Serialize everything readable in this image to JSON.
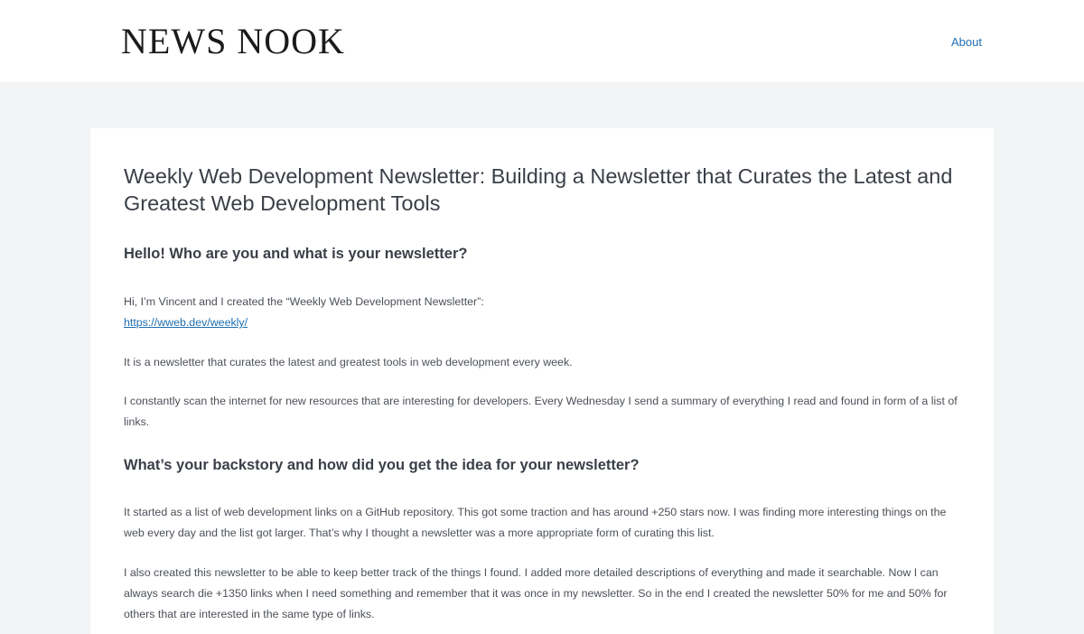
{
  "header": {
    "logo": "NEWS NOOK",
    "nav": {
      "about": "About"
    }
  },
  "article": {
    "title": "Weekly Web Development Newsletter: Building a Newsletter that Curates the Latest and Greatest Web Development Tools",
    "sections": [
      {
        "heading": "Hello! Who are you and what is your newsletter?",
        "paragraphs": [
          "Hi, I’m Vincent and I created the “Weekly Web Development Newsletter”:",
          "It is a newsletter that curates the latest and greatest tools in web development every week.",
          "I constantly scan the internet for new resources that are interesting for developers. Every Wednesday I send a summary of everything I read and found in form of a list of links."
        ],
        "link": "https://wweb.dev/weekly/"
      },
      {
        "heading": "What’s your backstory and how did you get the idea for your newsletter?",
        "paragraphs": [
          "It started as a list of web development links on a GitHub repository. This got some traction and has around +250 stars now. I was finding more interesting things on the web every day and the list got larger. That’s why I thought a newsletter was a more appropriate form of curating this list.",
          "I also created this newsletter to be able to keep better track of the things I found. I added more detailed descriptions of everything and made it searchable. Now I can always search die +1350 links when I need something and remember that it was once in my newsletter. So in the end I created the newsletter 50% for me and 50% for others that are interested in the same type of links."
        ]
      }
    ]
  }
}
